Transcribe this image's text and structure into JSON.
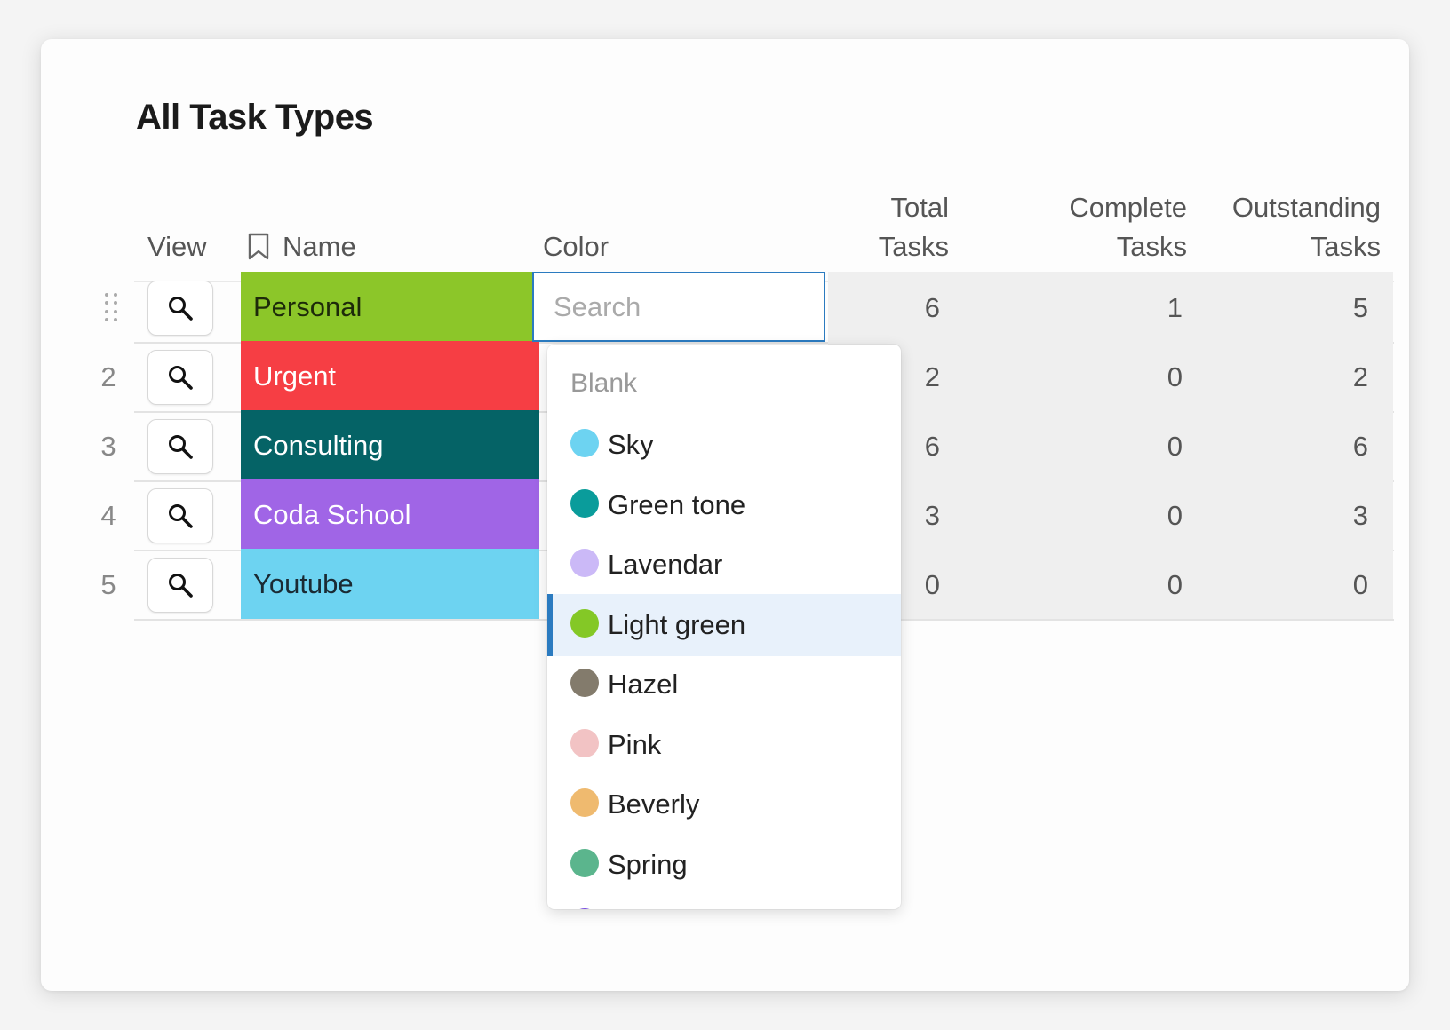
{
  "page": {
    "title": "All Task Types"
  },
  "columns": {
    "view": "View",
    "name": "Name",
    "color": "Color",
    "total": [
      "Total",
      "Tasks"
    ],
    "complete": [
      "Complete",
      "Tasks"
    ],
    "outstanding": [
      "Outstanding",
      "Tasks"
    ]
  },
  "rows": [
    {
      "num": "",
      "name": "Personal",
      "bg": "#8cc629",
      "fg": "#1d2a0a",
      "total": "6",
      "complete": "1",
      "outstanding": "5"
    },
    {
      "num": "2",
      "name": "Urgent",
      "bg": "#f63e44",
      "fg": "#ffffff",
      "total": "2",
      "complete": "0",
      "outstanding": "2"
    },
    {
      "num": "3",
      "name": "Consulting",
      "bg": "#056366",
      "fg": "#ffffff",
      "total": "6",
      "complete": "0",
      "outstanding": "6"
    },
    {
      "num": "4",
      "name": "Coda School",
      "bg": "#a065e6",
      "fg": "#ffffff",
      "total": "3",
      "complete": "0",
      "outstanding": "3"
    },
    {
      "num": "5",
      "name": "Youtube",
      "bg": "#6dd3f1",
      "fg": "#1a2a33",
      "total": "0",
      "complete": "0",
      "outstanding": "0"
    }
  ],
  "color_picker": {
    "search_placeholder": "Search",
    "search_value": "",
    "blank_label": "Blank",
    "options": [
      {
        "label": "Sky",
        "color": "#6dd3f1"
      },
      {
        "label": "Green tone",
        "color": "#0a9c9b"
      },
      {
        "label": "Lavendar",
        "color": "#cbb9f7"
      },
      {
        "label": "Light green",
        "color": "#84c826"
      },
      {
        "label": "Hazel",
        "color": "#837b6c"
      },
      {
        "label": "Pink",
        "color": "#f2c3c4"
      },
      {
        "label": "Beverly",
        "color": "#efba6f"
      },
      {
        "label": "Spring",
        "color": "#5bb58d"
      }
    ],
    "selected": "Light green",
    "next_option_color": "#7a4fe0"
  },
  "icons": {
    "view_button": "search-icon",
    "name_column": "bookmark-icon",
    "reorder": "drag-handle-icon"
  },
  "accent": "#2b7bc0"
}
